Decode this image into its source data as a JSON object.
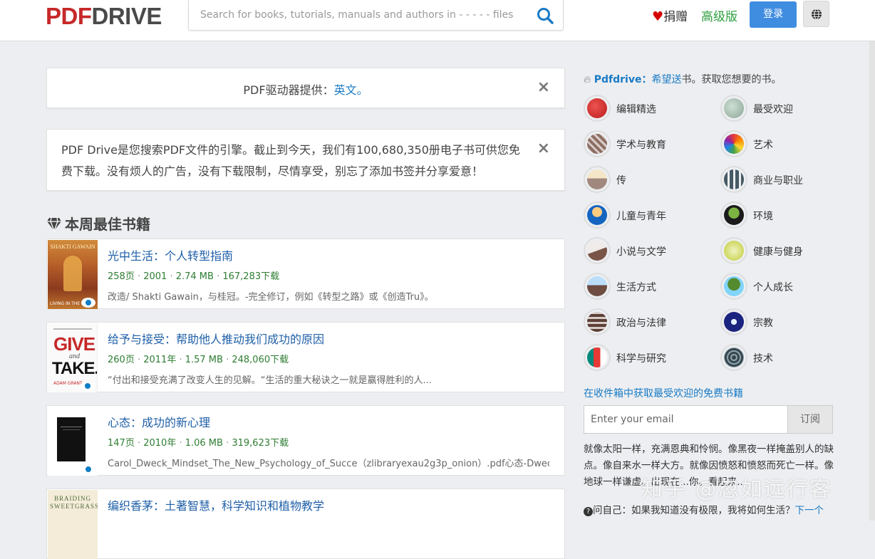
{
  "header": {
    "logo_part1": "PDF",
    "logo_part2": "DRIVE",
    "search_placeholder": "Search for books, tutorials, manuals and authors in - - - - - files",
    "donate_label": "捐赠",
    "premium_label": "高级版",
    "login_label": "登录"
  },
  "notices": {
    "lang_prefix": "PDF驱动器提供：",
    "lang_link": "英文。",
    "intro": "PDF Drive是您搜索PDF文件的引擎。截止到今天，我们有100,680,350册电子书可供您免费下载。没有烦人的广告，没有下载限制，尽情享受，别忘了添加书签并分享爱意！",
    "close_glyph": "×"
  },
  "section_title": "本周最佳书籍",
  "books": [
    {
      "title": "光中生活：个人转型指南",
      "pages": "258页",
      "year": "2001",
      "size": "2.74 MB",
      "downloads": "167,283下载",
      "desc": "改造/ Shakti Gawain，与桂冠。-完全修订，例如《转型之路》或《创造Tru》。"
    },
    {
      "title": "给予与接受：帮助他人推动我们成功的原因",
      "pages": "260页",
      "year": "2011年",
      "size": "1.57 MB",
      "downloads": "248,060下载",
      "desc": "“付出和接受充满了改变人生的见解。“生活的重大秘诀之一就是赢得胜利的人..."
    },
    {
      "title": "心态：成功的新心理",
      "pages": "147页",
      "year": "2010年",
      "size": "1.06 MB",
      "downloads": "319,623下载",
      "desc": "Carol_Dweck_Mindset_The_New_Psychology_of_Succe（zlibraryexau2g3p_onion）.pdf心态-Dweck_"
    },
    {
      "title": "编织香茅：土著智慧，科学知识和植物教学",
      "pages": "",
      "year": "",
      "size": "",
      "downloads": "",
      "desc": ""
    }
  ],
  "covers": {
    "book1": "SHAKTI GAWAIN",
    "book1_bottom": "LIVING IN THE",
    "book2_a": "GIVE",
    "book2_b": "and",
    "book2_c": "TAKE.",
    "book2_author": "ADAM GRANT",
    "book4": "BRAIDING SWEETGRASS"
  },
  "sidebar": {
    "tagline_brand": "Pdfdrive：",
    "tagline_link": "希望送",
    "tagline_rest": "书。获取您想要的书。",
    "categories": [
      {
        "label": "编辑精选",
        "color": "#b71c1c"
      },
      {
        "label": "最受欢迎",
        "color": "#9fb8a8"
      },
      {
        "label": "学术与教育",
        "color": "#8d6e63"
      },
      {
        "label": "艺术",
        "color": "#e65100"
      },
      {
        "label": "传",
        "color": "#a1887f"
      },
      {
        "label": "商业与职业",
        "color": "#455a64"
      },
      {
        "label": "儿童与青年",
        "color": "#1565c0"
      },
      {
        "label": "环境",
        "color": "#33691e"
      },
      {
        "label": "小说与文学",
        "color": "#795548"
      },
      {
        "label": "健康与健身",
        "color": "#c0ca33"
      },
      {
        "label": "生活方式",
        "color": "#6d4c41"
      },
      {
        "label": "个人成长",
        "color": "#558b2f"
      },
      {
        "label": "政治与法律",
        "color": "#5d4037"
      },
      {
        "label": "宗教",
        "color": "#1a237e"
      },
      {
        "label": "科学与研究",
        "color": "#00897b"
      },
      {
        "label": "技术",
        "color": "#37474f"
      }
    ],
    "newsletter_title": "在收件箱中获取最受欢迎的免费书籍",
    "email_placeholder": "Enter your email",
    "subscribe_label": "订阅",
    "quote": "就像太阳一样，充满恩典和怜悯。像黑夜一样掩盖别人的缺点。像自来水一样大方。就像因愤怒和愤怒而死亡一样。像地球一样谦虚。出现在...你。看起来...",
    "question_text": "问自己：如果我知道没有极限，我将如何生活？",
    "question_link": "下一个"
  },
  "watermark": "知乎 @忽如远行客",
  "colors": {
    "brand_red": "#c62828",
    "link_blue": "#1a7bc5",
    "green": "#2e9e3e",
    "button_blue": "#3f8de0"
  }
}
